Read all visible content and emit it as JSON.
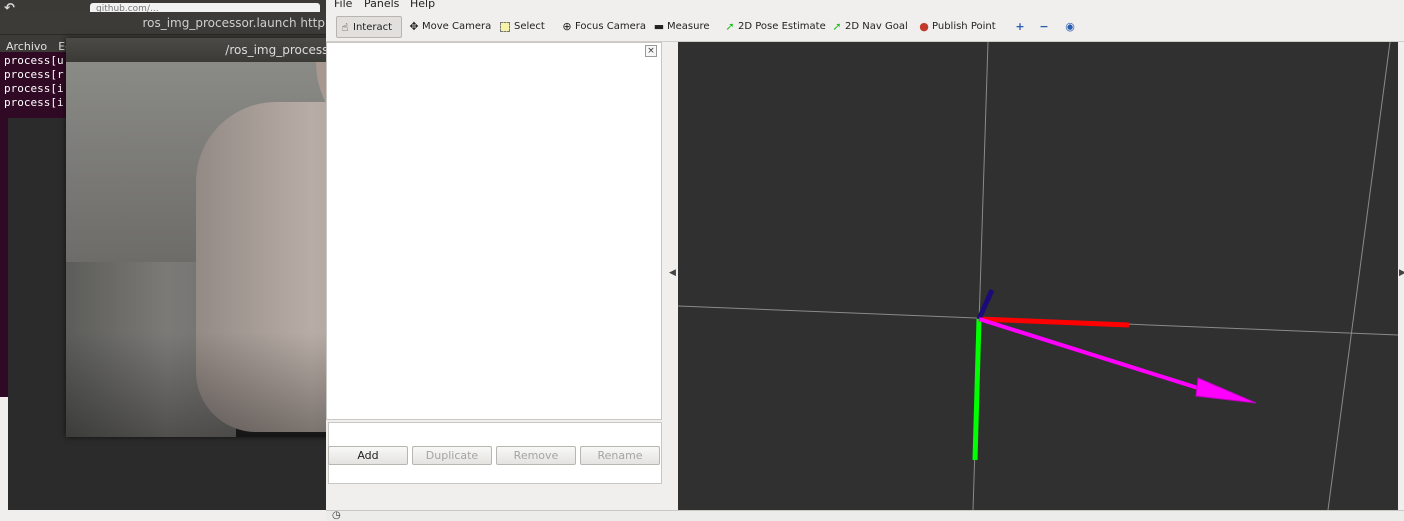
{
  "browser": {
    "nav_icon": "back-reload-icon",
    "url": "github.com/..."
  },
  "terminal": {
    "title": "ros_img_processor.launch http",
    "menu": [
      "Archivo",
      "Ed"
    ],
    "lines": [
      "process[u",
      "process[r",
      "process[i",
      "process[i"
    ]
  },
  "image_window": {
    "title": "/ros_img_processor/image_out"
  },
  "rviz": {
    "menu": {
      "file": "File",
      "panels": "Panels",
      "help": "Help"
    },
    "tools": {
      "interact": "Interact",
      "move_camera": "Move Camera",
      "select": "Select",
      "focus_camera": "Focus Camera",
      "measure": "Measure",
      "pose_estimate": "2D Pose Estimate",
      "nav_goal": "2D Nav Goal",
      "publish_point": "Publish Point"
    },
    "panel_buttons": {
      "add": "Add",
      "duplicate": "Duplicate",
      "remove": "Remove",
      "rename": "Rename"
    }
  },
  "colors": {
    "detection_box": "#22e0ee",
    "detection_center": "#19ee1b",
    "axis_x": "#ff0000",
    "axis_y": "#00ff00",
    "axis_z": "#1a0a7a",
    "arrow": "#ff00ff"
  }
}
